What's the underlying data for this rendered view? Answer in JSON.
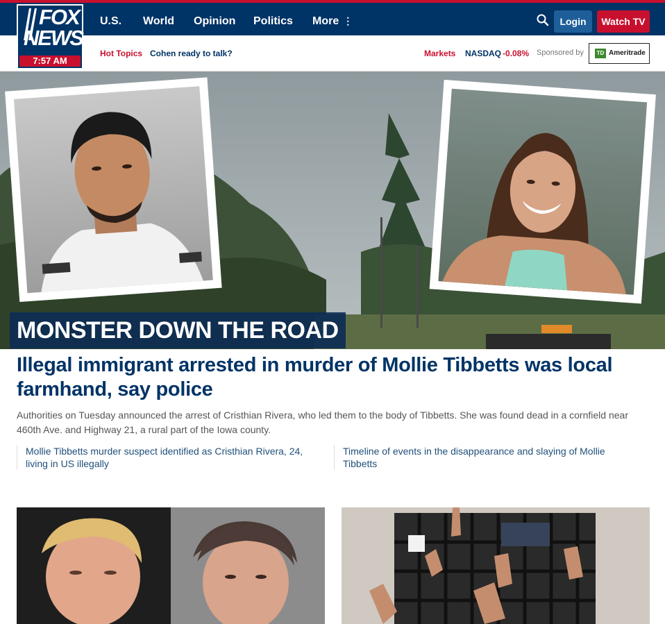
{
  "logo": {
    "line1": "FOX",
    "line2": "NEWS",
    "time": "7:57 AM"
  },
  "nav": {
    "items": [
      {
        "label": "U.S."
      },
      {
        "label": "World"
      },
      {
        "label": "Opinion"
      },
      {
        "label": "Politics"
      },
      {
        "label": "More"
      }
    ],
    "more_icon": "vertical-dots-icon",
    "search_icon": "search-icon",
    "login_label": "Login",
    "watch_label": "Watch TV"
  },
  "subnav": {
    "hot_topics_label": "Hot Topics",
    "hot_topic_link": "Cohen ready to talk?",
    "markets_label": "Markets",
    "index_name": "NASDAQ",
    "index_change": "-0.08%",
    "sponsored_label": "Sponsored by",
    "sponsor_mark": "TD",
    "sponsor_name": "Ameritrade"
  },
  "hero": {
    "banner": "MONSTER DOWN THE ROAD",
    "headline": "Illegal immigrant arrested in murder of Mollie Tibbetts was local farmhand, say police",
    "summary": "Authorities on Tuesday announced the arrest of Cristhian Rivera, who led them to the body of Tibbetts. She was found dead in a cornfield near 460th Ave. and Highway 21, a rural part of the Iowa county.",
    "related": [
      {
        "text": "Mollie Tibbetts murder suspect identified as Cristhian Rivera, 24, living in US illegally"
      },
      {
        "text": "Timeline of events in the disappearance and slaying of Mollie Tibbetts"
      }
    ]
  },
  "colors": {
    "brand_navy": "#003366",
    "brand_red": "#c8102e",
    "link_blue": "#1f4f7a",
    "login_blue": "#1f5f99"
  }
}
